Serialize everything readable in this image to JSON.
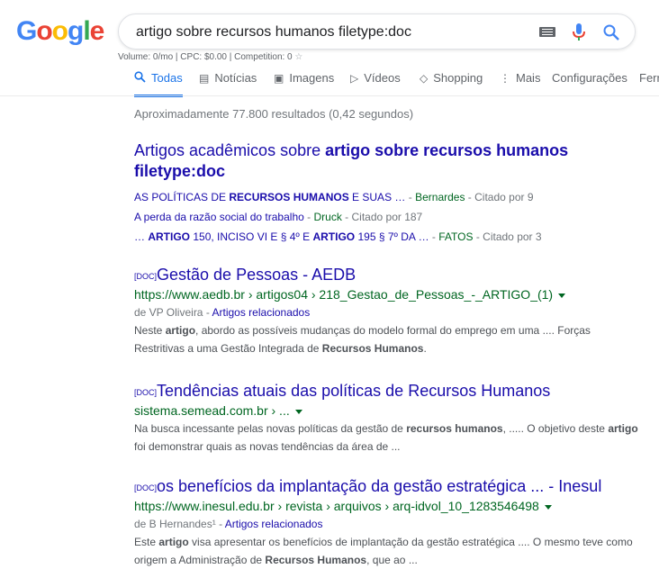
{
  "logo": {
    "letters": [
      "G",
      "o",
      "o",
      "g",
      "l",
      "e"
    ],
    "colors": [
      "#4285f4",
      "#ea4335",
      "#fbbc05",
      "#4285f4",
      "#34a853",
      "#ea4335"
    ]
  },
  "search": {
    "query": "artigo sobre recursos humanos filetype:doc"
  },
  "volume_bar": "Volume: 0/mo | CPC: $0.00 | Competition: 0",
  "tabs": [
    {
      "label": "Todas",
      "icon": "search-icon"
    },
    {
      "label": "Notícias",
      "icon": "news-icon"
    },
    {
      "label": "Imagens",
      "icon": "image-icon"
    },
    {
      "label": "Vídeos",
      "icon": "video-icon"
    },
    {
      "label": "Shopping",
      "icon": "tag-icon"
    },
    {
      "label": "Mais",
      "icon": "more-vert-icon"
    },
    {
      "label": "Configurações",
      "icon": ""
    },
    {
      "label": "Ferr",
      "icon": ""
    }
  ],
  "stats": "Aproximadamente 77.800 resultados (0,42 segundos)",
  "scholar": {
    "title_plain": "Artigos acadêmicos sobre ",
    "title_bold": "artigo sobre recursos humanos filetype:doc",
    "items": [
      {
        "a": "AS POLÍTICAS DE ",
        "b": "RECURSOS HUMANOS",
        "c": " E SUAS …",
        "author": "Bernardes",
        "cited": "Citado por 9"
      },
      {
        "a": "A perda da razão social do trabalho",
        "b": "",
        "c": "",
        "author": "Druck",
        "cited": "Citado por 187"
      },
      {
        "a": "… ",
        "b": "ARTIGO",
        "c": " 150, INCISO VI E § 4º E ",
        "b2": "ARTIGO",
        "c2": " 195 § 7º DA …",
        "author": "FATOS",
        "cited": "Citado por 3"
      }
    ]
  },
  "results": [
    {
      "tag": "[DOC]",
      "title": "Gestão de Pessoas - AEDB",
      "url": "https://www.aedb.br › artigos04 › 218_Gestao_de_Pessoas_-_ARTIGO_(1)",
      "meta_author": "de VP Oliveira",
      "meta_link": "Artigos relacionados",
      "snippet": [
        {
          "t": "Neste ",
          "b": false
        },
        {
          "t": "artigo",
          "b": true
        },
        {
          "t": ", abordo as possíveis mudanças do modelo formal do emprego em uma .... Forças Restritivas a uma Gestão Integrada de ",
          "b": false
        },
        {
          "t": "Recursos Humanos",
          "b": true
        },
        {
          "t": ".",
          "b": false
        }
      ]
    },
    {
      "tag": "[DOC]",
      "title": "Tendências atuais das políticas de Recursos Humanos",
      "url": "sistema.semead.com.br › ...",
      "meta_author": "",
      "meta_link": "",
      "snippet": [
        {
          "t": "Na busca incessante pelas novas políticas da gestão de ",
          "b": false
        },
        {
          "t": "recursos humanos",
          "b": true
        },
        {
          "t": ", ..... O objetivo deste ",
          "b": false
        },
        {
          "t": "artigo",
          "b": true
        },
        {
          "t": " foi demonstrar quais as novas tendências da área de ...",
          "b": false
        }
      ]
    },
    {
      "tag": "[DOC]",
      "title": "os benefícios da implantação da gestão estratégica ... - Inesul",
      "url": "https://www.inesul.edu.br › revista › arquivos › arq-idvol_10_1283546498",
      "meta_author": "de B Hernandes¹",
      "meta_link": "Artigos relacionados",
      "snippet": [
        {
          "t": "Este ",
          "b": false
        },
        {
          "t": "artigo",
          "b": true
        },
        {
          "t": " visa apresentar os benefícios de implantação da gestão estratégica .... O mesmo teve como origem a Administração de ",
          "b": false
        },
        {
          "t": "Recursos Humanos",
          "b": true
        },
        {
          "t": ", que ao ...",
          "b": false
        }
      ]
    }
  ]
}
